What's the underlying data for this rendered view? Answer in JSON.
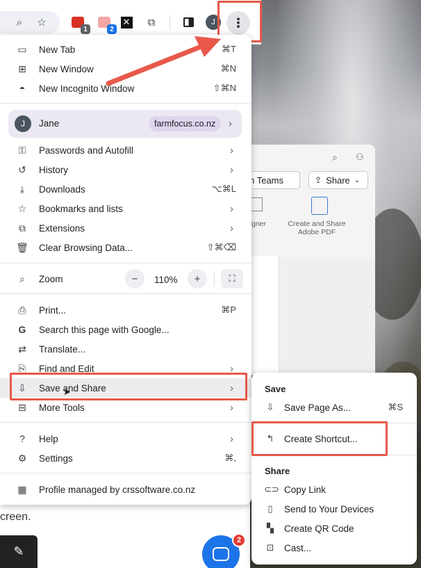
{
  "toolbar": {
    "icons": [
      "zoom-icon",
      "star-icon",
      "extension-red-icon",
      "extension-pink-icon",
      "extension-x-icon",
      "puzzle-icon",
      "side-panel-icon",
      "profile-avatar",
      "more-icon"
    ],
    "badge_red": "1",
    "badge_blue": "2",
    "avatar_initial": "J",
    "more_glyph": "⋮"
  },
  "menu": {
    "new_tab": {
      "label": "New Tab",
      "shortcut": "⌘T"
    },
    "new_window": {
      "label": "New Window",
      "shortcut": "⌘N"
    },
    "new_incognito": {
      "label": "New Incognito Window",
      "shortcut": "⇧⌘N"
    },
    "profile": {
      "initial": "J",
      "name": "Jane",
      "domain": "farmfocus.co.nz"
    },
    "passwords": {
      "label": "Passwords and Autofill"
    },
    "history": {
      "label": "History"
    },
    "downloads": {
      "label": "Downloads",
      "shortcut": "⌥⌘L"
    },
    "bookmarks": {
      "label": "Bookmarks and lists"
    },
    "extensions": {
      "label": "Extensions"
    },
    "clear_data": {
      "label": "Clear Browsing Data...",
      "shortcut": "⇧⌘⌫"
    },
    "zoom": {
      "label": "Zoom",
      "value": "110%",
      "minus": "−",
      "plus": "+"
    },
    "print": {
      "label": "Print...",
      "shortcut": "⌘P"
    },
    "search_page": {
      "label": "Search this page with Google..."
    },
    "translate": {
      "label": "Translate..."
    },
    "find_edit": {
      "label": "Find and Edit"
    },
    "save_share": {
      "label": "Save and Share"
    },
    "more_tools": {
      "label": "More Tools"
    },
    "help": {
      "label": "Help"
    },
    "settings": {
      "label": "Settings",
      "shortcut": "⌘,"
    },
    "managed": {
      "label": "Profile managed by crssoftware.co.nz"
    }
  },
  "submenu": {
    "save_heading": "Save",
    "save_page": {
      "label": "Save Page As...",
      "shortcut": "⌘S"
    },
    "create_shortcut": {
      "label": "Create Shortcut..."
    },
    "share_heading": "Share",
    "copy_link": {
      "label": "Copy Link"
    },
    "send_devices": {
      "label": "Send to Your Devices"
    },
    "qr_code": {
      "label": "Create QR Code"
    },
    "cast": {
      "label": "Cast..."
    }
  },
  "background": {
    "teams_chip": "t in Teams",
    "share_chip": "Share",
    "designer_label": "gner",
    "adobe_label_1": "Create and Share",
    "adobe_label_2": "Adobe PDF",
    "page_text": "creen.",
    "chat_badge": "2"
  },
  "colors": {
    "highlight": "#e8594a",
    "profile_bg": "#ebe8f2",
    "domain_chip": "#ddd6ee",
    "chat_blue": "#1c74e8"
  }
}
